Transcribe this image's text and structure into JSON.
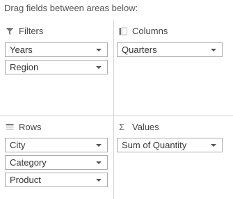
{
  "header": {
    "text": "Drag fields between areas below:"
  },
  "areas": {
    "filters": {
      "title": "Filters",
      "icon": "filter-icon",
      "fields": [
        "Years",
        "Region"
      ]
    },
    "columns": {
      "title": "Columns",
      "icon": "columns-icon",
      "fields": [
        "Quarters"
      ]
    },
    "rows": {
      "title": "Rows",
      "icon": "rows-icon",
      "fields": [
        "City",
        "Category",
        "Product"
      ]
    },
    "values": {
      "title": "Values",
      "icon": "sigma-icon",
      "icon_glyph": "Σ",
      "fields": [
        "Sum of Quantity"
      ]
    }
  },
  "colors": {
    "divider": "#d2d2d2",
    "field_border": "#ababab",
    "icon": "#777777"
  }
}
